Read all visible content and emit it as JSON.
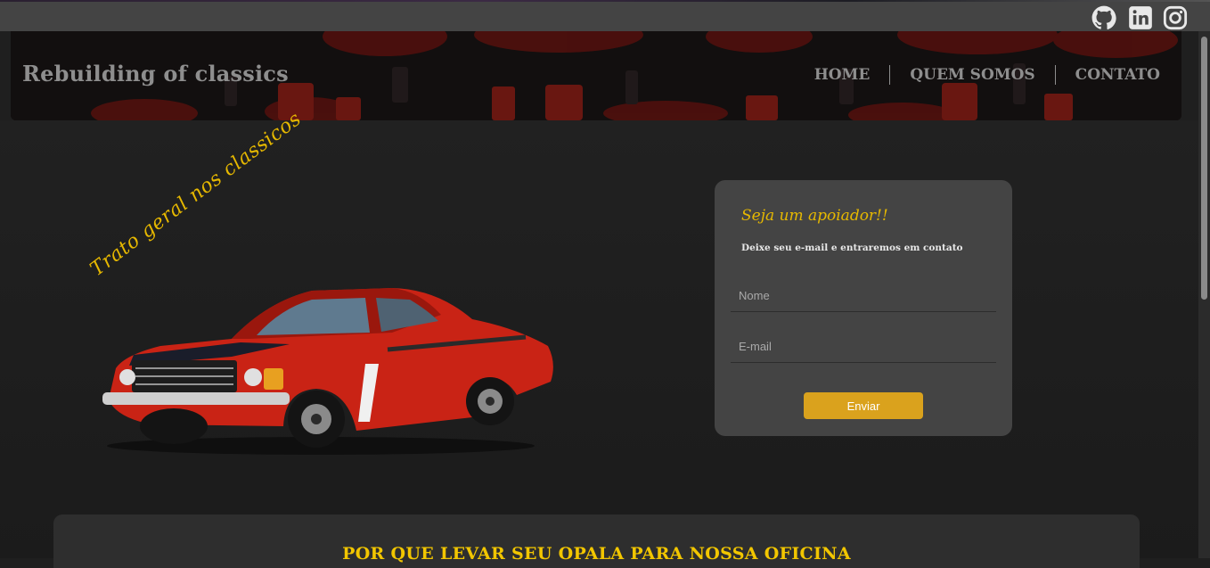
{
  "social": {
    "icons": [
      "github-icon",
      "linkedin-icon",
      "instagram-icon"
    ]
  },
  "header": {
    "brand": "Rebuilding of classics",
    "nav": [
      "HOME",
      "QUEM SOMOS",
      "CONTATO"
    ]
  },
  "hero": {
    "tagline": "Trato geral nos classicos"
  },
  "form": {
    "title": "Seja um apoiador!!",
    "subtitle": "Deixe seu e-mail e entraremos em contato",
    "name_placeholder": "Nome",
    "email_placeholder": "E-mail",
    "submit_label": "Enviar"
  },
  "section": {
    "title": "POR QUE LEVAR SEU OPALA PARA NOSSA OFICINA"
  },
  "colors": {
    "accent": "#e6b800",
    "button": "#daa21d",
    "card": "#444444",
    "background": "#1f1f1f"
  }
}
